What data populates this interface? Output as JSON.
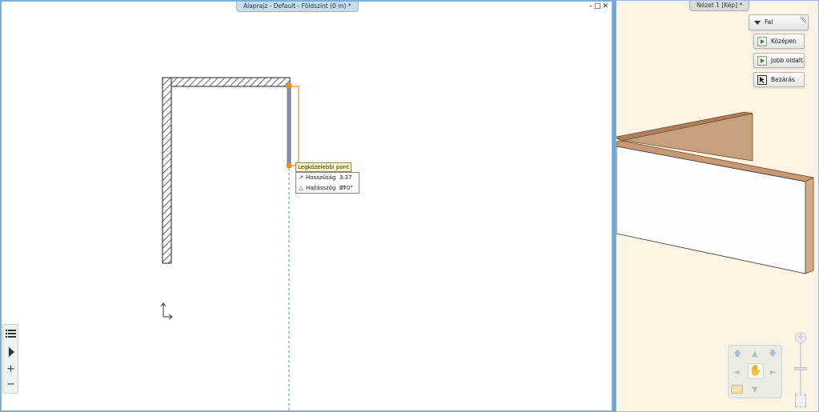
{
  "plan_window": {
    "title": "Alaprajz - Default - Földszint (0 m) *",
    "controls": "–□✕"
  },
  "view_window": {
    "title": "Nézet 1 [Kép] *"
  },
  "command_panel": {
    "wall_label": "Fal",
    "center_label": "Középen",
    "right_side_label": "Jobb oldalt",
    "close_label": "Bezárás"
  },
  "snap_tooltip": "Legközelebbi pont",
  "measurements": {
    "length_label": "Hosszúság",
    "length_value": "3.37 m",
    "angle_label": "Hajlásszög",
    "angle_value": "270°"
  },
  "left_toolbar": {
    "items": [
      "list-icon",
      "play-icon",
      "zoom-in-icon",
      "zoom-out-icon"
    ]
  },
  "colors": {
    "accent_orange": "#f08a1c",
    "guide_green": "#2fa84f",
    "wall_face": "#fefefe",
    "wall_top": "#c79a75"
  }
}
